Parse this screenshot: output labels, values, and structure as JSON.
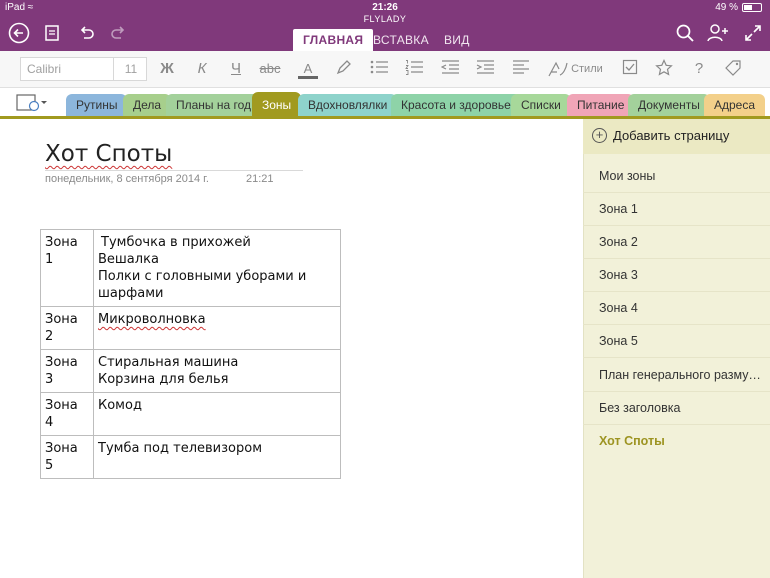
{
  "status": {
    "device": "iPad",
    "time": "21:26",
    "battery": "49 %",
    "notebook": "FLYLADY"
  },
  "ribbon_tabs": [
    {
      "label": "ГЛАВНАЯ",
      "active": true
    },
    {
      "label": "ВСТАВКА",
      "active": false
    },
    {
      "label": "ВИД",
      "active": false
    }
  ],
  "toolbar": {
    "font_name": "Calibri",
    "font_size": "11",
    "bold": "Ж",
    "italic": "К",
    "underline": "Ч",
    "strike": "abc",
    "font_color": "A",
    "styles": "Стили"
  },
  "sections": [
    {
      "label": "Рутины",
      "color": "#8cb6dc"
    },
    {
      "label": "Дела",
      "color": "#a7cf8c"
    },
    {
      "label": "Планы на год",
      "color": "#a3d19b"
    },
    {
      "label": "Зоны",
      "color": "#a19a1f"
    },
    {
      "label": "Вдохновлялки",
      "color": "#8ed3cb"
    },
    {
      "label": "Красота и здоровье",
      "color": "#8ed3a8"
    },
    {
      "label": "Списки",
      "color": "#a7d89a"
    },
    {
      "label": "Питание",
      "color": "#f0a5b7"
    },
    {
      "label": "Документы",
      "color": "#a3d19b"
    },
    {
      "label": "Адреса",
      "color": "#f3d08a"
    }
  ],
  "page": {
    "title": "Хот Споты",
    "date": "понедельник,  8 сентября  2014 г.",
    "time": "21:21"
  },
  "table": [
    {
      "zone": "Зона 1",
      "items": [
        "Тумбочка в прихожей",
        "Вешалка",
        "Полки с головными уборами и шарфами"
      ]
    },
    {
      "zone": "Зона 2",
      "items": [
        "Микроволновка"
      ]
    },
    {
      "zone": "Зона 3",
      "items": [
        "Стиральная машина",
        "Корзина для белья"
      ]
    },
    {
      "zone": "Зона 4",
      "items": [
        "Комод"
      ]
    },
    {
      "zone": "Зона 5",
      "items": [
        "Тумба под телевизором"
      ]
    }
  ],
  "pages_panel": {
    "add_label": "Добавить страницу",
    "items": [
      {
        "label": "Мои зоны"
      },
      {
        "label": "Зона 1"
      },
      {
        "label": "Зона 2"
      },
      {
        "label": "Зона 3"
      },
      {
        "label": "Зона 4"
      },
      {
        "label": "Зона 5"
      },
      {
        "label": "План генерального размусоривания"
      },
      {
        "label": "Без заголовка"
      },
      {
        "label": "Хот Споты",
        "active": true
      }
    ]
  },
  "colors": {
    "accent": "#80397b",
    "section_active": "#a19a1f",
    "pages_bg": "#f2f1d9"
  }
}
